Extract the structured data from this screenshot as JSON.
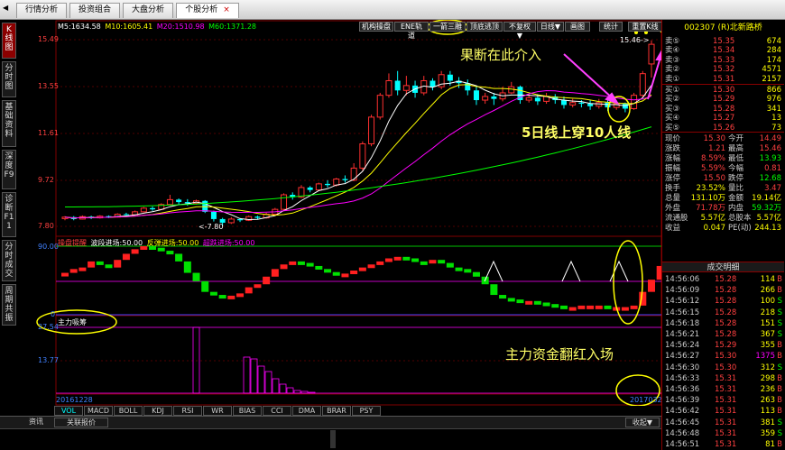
{
  "top_tabs": [
    {
      "label": "行情分析"
    },
    {
      "label": "投资组合"
    },
    {
      "label": "大盘分析"
    },
    {
      "label": "个股分析",
      "close": "×"
    }
  ],
  "side_tabs": [
    "K线图",
    "分时图",
    "基础资料",
    "深度F9",
    "诊断F11",
    "分时成交",
    "周期共振"
  ],
  "ma_legend": [
    {
      "text": "M5:1634.58",
      "color": "#ffffff"
    },
    {
      "text": "M10:1605.41",
      "color": "#ffff00"
    },
    {
      "text": "M20:1510.98",
      "color": "#ff00ff"
    },
    {
      "text": "M60:1371.28",
      "color": "#00ff00"
    }
  ],
  "toolbar": [
    "机构操盘",
    "ENE轨道",
    "一箭三雕",
    "顶底逃顶",
    "不复权▼",
    "日线▼",
    "画图",
    "统计",
    "重置K线"
  ],
  "price_axis": [
    "15.49",
    "13.55",
    "11.61",
    "9.72",
    "7.80"
  ],
  "price_annotations": {
    "high": "15.46->",
    "low": "<-7.80"
  },
  "ind1": {
    "title": "操盘提醒",
    "items": [
      {
        "text": "波段进场:50.00",
        "color": "#ffffff"
      },
      {
        "text": "反弹进场:50.00",
        "color": "#ffff00"
      },
      {
        "text": "超跌进场:50.00",
        "color": "#ff00ff"
      }
    ],
    "axis": [
      "90.00",
      "0"
    ]
  },
  "ind2": {
    "title": "主力吸筹",
    "axis": [
      "27.54",
      "13.77"
    ]
  },
  "dates": {
    "start": "20161228",
    "end": "20170320"
  },
  "indicator_tabs": [
    "VOL",
    "MACD",
    "BOLL",
    "KDJ",
    "RSI",
    "WR",
    "BIAS",
    "CCI",
    "DMA",
    "BRAR",
    "PSY"
  ],
  "bottom": {
    "tab1": "资讯",
    "tab2": "关联报价",
    "collapse": "收起"
  },
  "annotations": {
    "intervene": "果断在此介入",
    "cross": "5日线上穿10人线",
    "capital": "主力资金翻红入场"
  },
  "stock": {
    "code": "002307",
    "name": "(R)北新路桥"
  },
  "sell_orders": [
    {
      "label": "卖⑤",
      "price": "15.35",
      "vol": "674"
    },
    {
      "label": "卖④",
      "price": "15.34",
      "vol": "284"
    },
    {
      "label": "卖③",
      "price": "15.33",
      "vol": "174"
    },
    {
      "label": "卖②",
      "price": "15.32",
      "vol": "4571"
    },
    {
      "label": "卖①",
      "price": "15.31",
      "vol": "2157"
    }
  ],
  "buy_orders": [
    {
      "label": "买①",
      "price": "15.30",
      "vol": "866"
    },
    {
      "label": "买②",
      "price": "15.29",
      "vol": "976"
    },
    {
      "label": "买③",
      "price": "15.28",
      "vol": "341"
    },
    {
      "label": "买④",
      "price": "15.27",
      "vol": "13"
    },
    {
      "label": "买⑤",
      "price": "15.26",
      "vol": "73"
    }
  ],
  "stats": [
    {
      "l1": "现价",
      "v1": "15.30",
      "c1": "#ff4040",
      "l2": "今开",
      "v2": "14.49",
      "c2": "#ff4040"
    },
    {
      "l1": "涨跌",
      "v1": "1.21",
      "c1": "#ff4040",
      "l2": "最高",
      "v2": "15.46",
      "c2": "#ff4040"
    },
    {
      "l1": "涨幅",
      "v1": "8.59%",
      "c1": "#ff4040",
      "l2": "最低",
      "v2": "13.93",
      "c2": "#00ff00"
    },
    {
      "l1": "振幅",
      "v1": "5.59%",
      "c1": "#ff4040",
      "l2": "今幅",
      "v2": "0.81",
      "c2": "#ff4040"
    },
    {
      "l1": "涨停",
      "v1": "15.50",
      "c1": "#ff4040",
      "l2": "跌停",
      "v2": "12.68",
      "c2": "#00ff00"
    },
    {
      "l1": "换手",
      "v1": "23.52%",
      "c1": "#ffff00",
      "l2": "量比",
      "v2": "3.47",
      "c2": "#ff4040"
    },
    {
      "l1": "总量",
      "v1": "131.10万",
      "c1": "#ffff00",
      "l2": "金额",
      "v2": "19.14亿",
      "c2": "#ffff00"
    },
    {
      "l1": "外盘",
      "v1": "71.78万",
      "c1": "#ff4040",
      "l2": "内盘",
      "v2": "59.32万",
      "c2": "#00ff00"
    },
    {
      "l1": "流通股",
      "v1": "5.57亿",
      "c1": "#ffff00",
      "l2": "总股本",
      "v2": "5.57亿",
      "c2": "#ffff00"
    },
    {
      "l1": "收益",
      "v1": "0.047",
      "c1": "#ffff00",
      "l2": "PE(动)",
      "v2": "244.13",
      "c2": "#ffff00"
    }
  ],
  "trades_title": "成交明细",
  "trades": [
    {
      "t": "14:56:06",
      "p": "15.28",
      "v": "114",
      "b": "B"
    },
    {
      "t": "14:56:09",
      "p": "15.28",
      "v": "266",
      "b": "B"
    },
    {
      "t": "14:56:12",
      "p": "15.28",
      "v": "100",
      "b": "S"
    },
    {
      "t": "14:56:15",
      "p": "15.28",
      "v": "218",
      "b": "S"
    },
    {
      "t": "14:56:18",
      "p": "15.28",
      "v": "151",
      "b": "S"
    },
    {
      "t": "14:56:21",
      "p": "15.28",
      "v": "367",
      "b": "S"
    },
    {
      "t": "14:56:24",
      "p": "15.29",
      "v": "355",
      "b": "B"
    },
    {
      "t": "14:56:27",
      "p": "15.30",
      "v": "1375",
      "b": "B"
    },
    {
      "t": "14:56:30",
      "p": "15.30",
      "v": "312",
      "b": "S"
    },
    {
      "t": "14:56:33",
      "p": "15.31",
      "v": "298",
      "b": "B"
    },
    {
      "t": "14:56:36",
      "p": "15.31",
      "v": "236",
      "b": "B"
    },
    {
      "t": "14:56:39",
      "p": "15.31",
      "v": "263",
      "b": "B"
    },
    {
      "t": "14:56:42",
      "p": "15.31",
      "v": "113",
      "b": "B"
    },
    {
      "t": "14:56:45",
      "p": "15.31",
      "v": "381",
      "b": "S"
    },
    {
      "t": "14:56:48",
      "p": "15.31",
      "v": "359",
      "b": "S"
    },
    {
      "t": "14:56:51",
      "p": "15.31",
      "v": "81",
      "b": "B"
    }
  ]
}
